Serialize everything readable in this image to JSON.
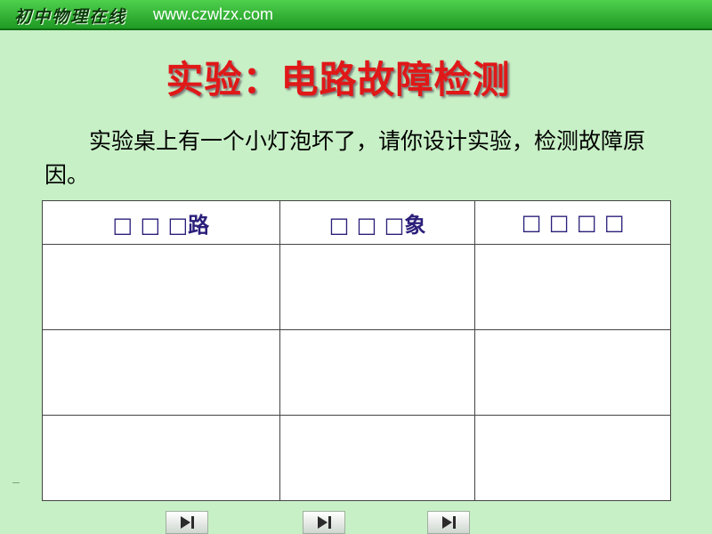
{
  "header": {
    "brand": "初中物理在线",
    "url": "www.czwlzx.com"
  },
  "slide": {
    "title": "实验：电路故障检测",
    "paragraph": "实验桌上有一个小灯泡坏了，请你设计实验，检测故障原因。"
  },
  "table": {
    "headers": [
      "□ □ □路",
      "□ □ □象",
      "□ □ □ □"
    ],
    "rows": [
      [
        "",
        "",
        ""
      ],
      [
        "",
        "",
        ""
      ],
      [
        "",
        "",
        ""
      ]
    ]
  },
  "nav_buttons": [
    {
      "icon": "play-to-end-icon"
    },
    {
      "icon": "play-to-end-icon"
    },
    {
      "icon": "play-to-end-icon"
    }
  ],
  "colors": {
    "background": "#c8f0c6",
    "header_green": "#2aa52e",
    "title_red": "#e01818",
    "table_header_text": "#2a1f7a"
  }
}
